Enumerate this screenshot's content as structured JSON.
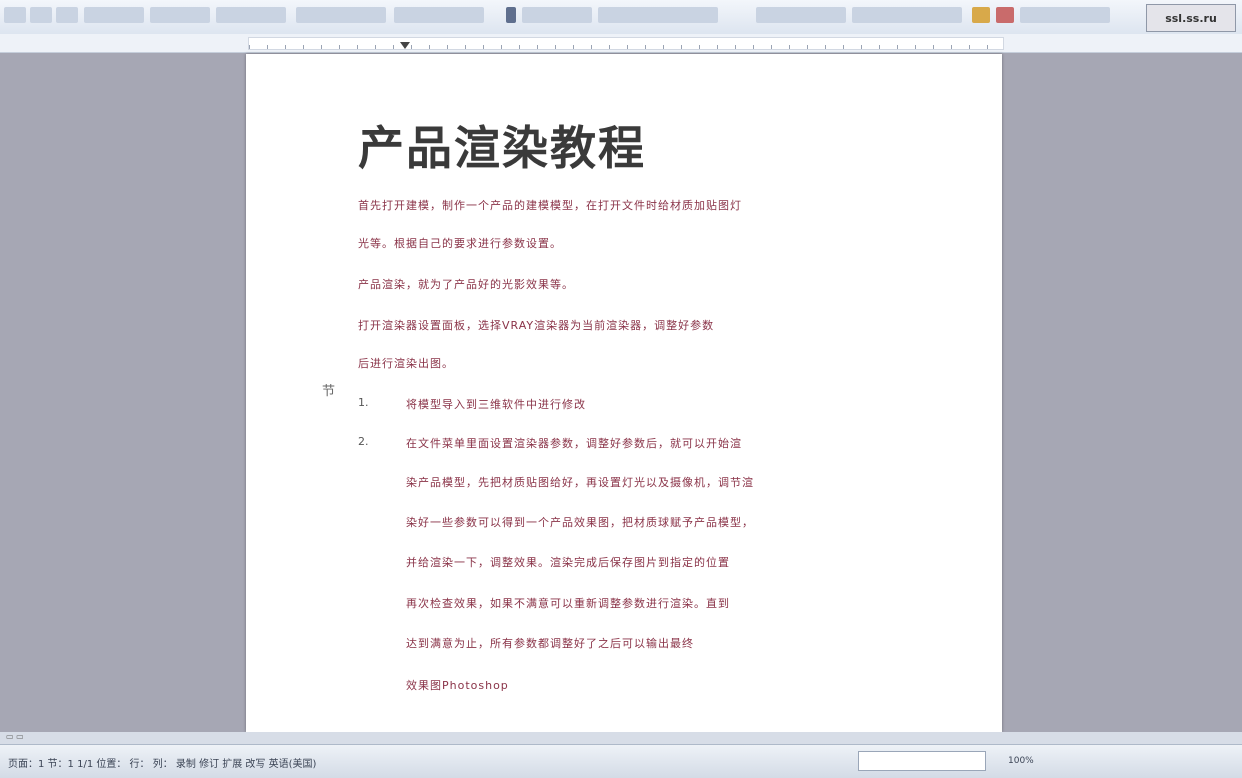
{
  "toolbar": {
    "corner_label": "ssl.ss.ru"
  },
  "document": {
    "title": "产品渲染教程",
    "paragraphs": [
      "首先打开建模，制作一个产品的建模模型，在打开文件时给材质加贴图灯",
      "光等。根据自己的要求进行参数设置。",
      "产品渲染，就为了产品好的光影效果等。",
      "打开渲染器设置面板，选择VRAY渲染器为当前渲染器，调整好参数",
      "后进行渲染出图。"
    ],
    "list": [
      {
        "num": "1.",
        "lines": [
          "将模型导入到三维软件中进行修改"
        ]
      },
      {
        "num": "2.",
        "lines": [
          "在文件菜单里面设置渲染器参数，调整好参数后，就可以开始渲",
          "染产品模型，先把材质贴图给好，再设置灯光以及摄像机，调节渲",
          "染好一些参数可以得到一个产品效果图，把材质球赋予产品模型，",
          "并给渲染一下，调整效果。渲染完成后保存图片到指定的位置",
          "再次检查效果，如果不满意可以重新调整参数进行渲染。直到",
          "达到满意为止，所有参数都调整好了之后可以输出最终",
          "效果图Photoshop"
        ]
      }
    ],
    "margin_mark": "节"
  },
  "statusbar": {
    "left_text": "页面：1  节：1  1/1  位置：  行：  列：  录制  修订  扩展  改写  英语(美国)",
    "box_text": "",
    "right_text": "100%"
  }
}
